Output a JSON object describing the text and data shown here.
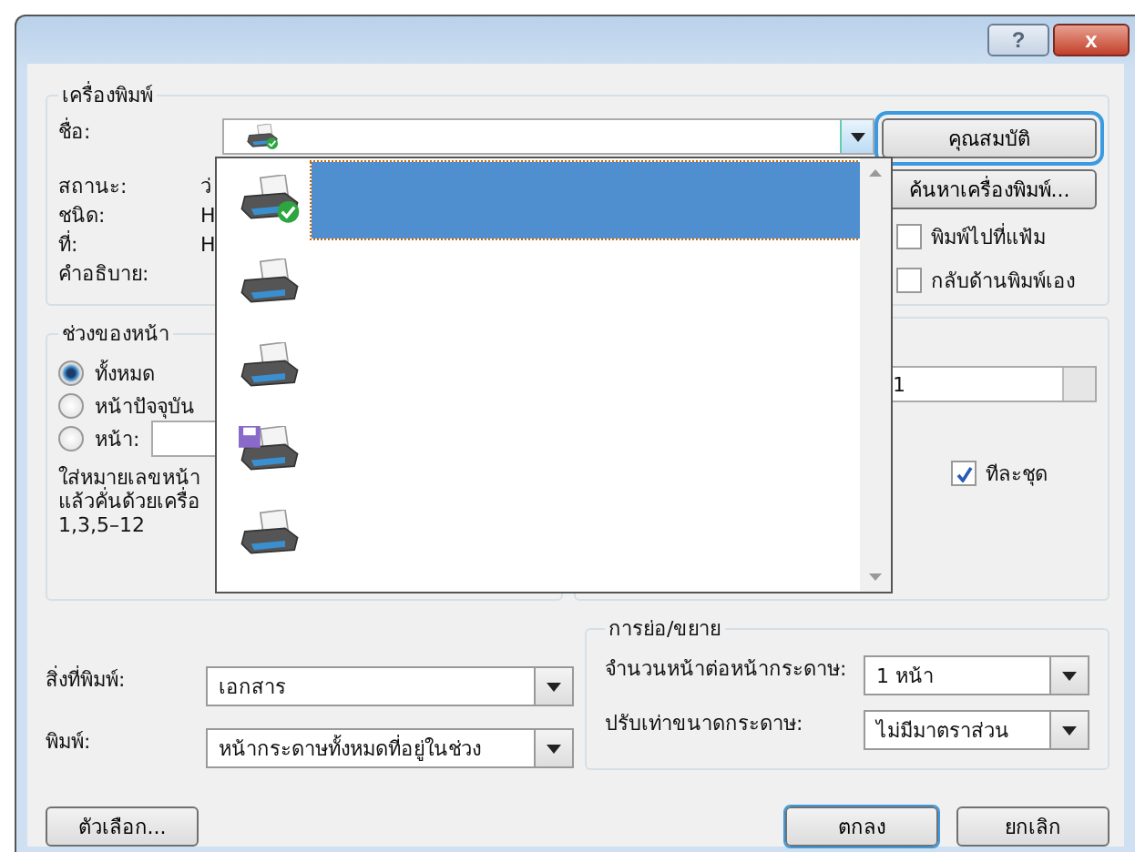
{
  "window": {
    "help": "?",
    "close": "x"
  },
  "printer": {
    "title": "เครื่องพิมพ์",
    "name_label": "ชื่อ:",
    "info": [
      {
        "label": "สถานะ:",
        "value": "ว่"
      },
      {
        "label": "ชนิด:",
        "value": "H"
      },
      {
        "label": "ที่:",
        "value": "H"
      },
      {
        "label": "คำอธิบาย:"
      }
    ],
    "properties_button": "คุณสมบัติ",
    "find_button": "ค้นหาเครื่องพิมพ์...",
    "checkboxes": [
      {
        "label": "พิมพ์ไปที่แฟ้ม",
        "checked": false
      },
      {
        "label": "กลับด้านพิมพ์เอง",
        "checked": false
      }
    ]
  },
  "dropdown": {
    "items": [
      {
        "kind": "default",
        "selected": true
      },
      {
        "kind": "plain",
        "selected": false
      },
      {
        "kind": "plain",
        "selected": false
      },
      {
        "kind": "fax",
        "selected": false
      },
      {
        "kind": "plain",
        "selected": false
      }
    ]
  },
  "page_range": {
    "title": "ช่วงของหน้า",
    "options": [
      {
        "label": "ทั้งหมด",
        "selected": true
      },
      {
        "label": "หน้าปัจจุบัน",
        "selected": false
      },
      {
        "label": "หน้า:",
        "selected": false
      }
    ],
    "hint": [
      "ใส่หมายเลขหน้า",
      "แล้วคั่นด้วยเครื่อ",
      "1,3,5–12"
    ]
  },
  "copies": {
    "value": "1",
    "collate": {
      "label": "ทีละชุด",
      "checked": true
    }
  },
  "print_what": {
    "label": "สิ่งที่พิมพ์:",
    "value": "เอกสาร"
  },
  "print": {
    "label": "พิมพ์:",
    "value": "หน้ากระดาษทั้งหมดที่อยู่ในช่วง"
  },
  "zoom": {
    "title": "การย่อ/ขยาย",
    "rows": [
      {
        "label": "จำนวนหน้าต่อหน้ากระดาษ:",
        "value": "1 หน้า"
      },
      {
        "label": "ปรับเท่าขนาดกระดาษ:",
        "value": "ไม่มีมาตราส่วน"
      }
    ]
  },
  "buttons": {
    "options": "ตัวเลือก...",
    "ok": "ตกลง",
    "cancel": "ยกเลิก"
  }
}
